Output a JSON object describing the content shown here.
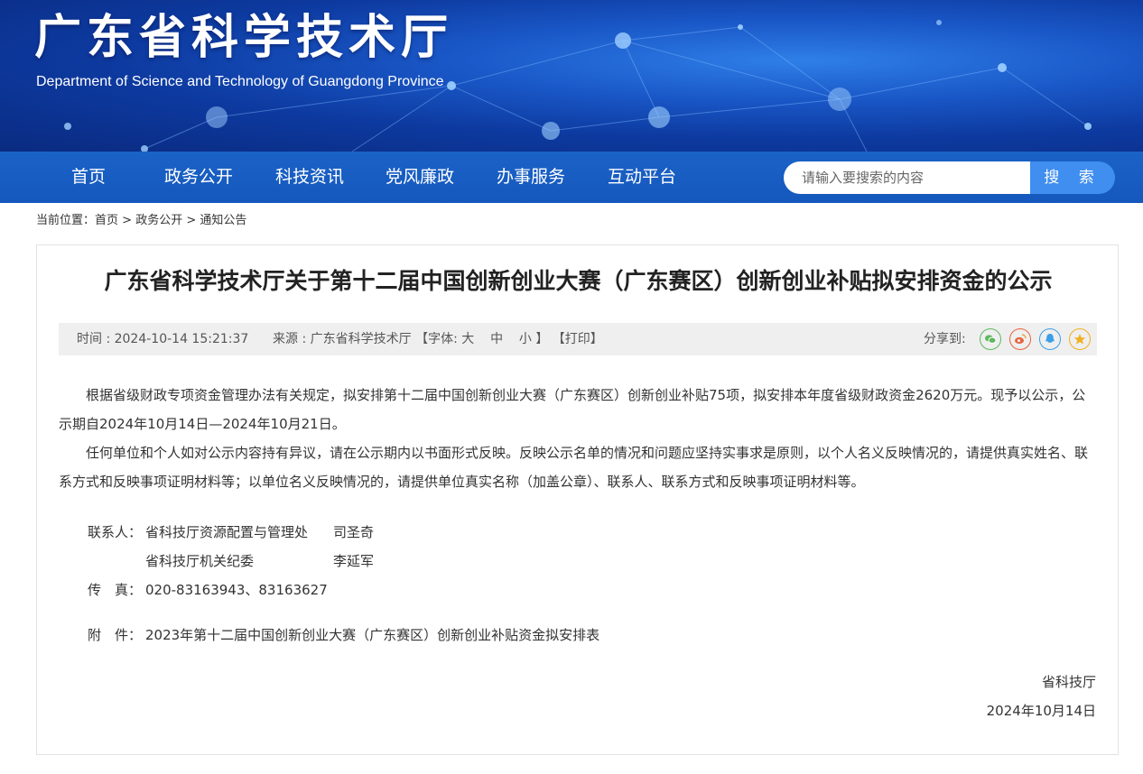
{
  "header": {
    "title": "广东省科学技术厅",
    "subtitle": "Department of Science and Technology of Guangdong Province"
  },
  "nav": {
    "items": [
      "首页",
      "政务公开",
      "科技资讯",
      "党风廉政",
      "办事服务",
      "互动平台"
    ]
  },
  "search": {
    "placeholder": "请输入要搜索的内容",
    "button": "搜 索"
  },
  "breadcrumb": {
    "prefix": "当前位置：",
    "items": [
      "首页",
      "政务公开",
      "通知公告"
    ],
    "sep": ">"
  },
  "article": {
    "title": "广东省科学技术厅关于第十二届中国创新创业大赛（广东赛区）创新创业补贴拟安排资金的公示",
    "meta": {
      "time": "时间 : 2024-10-14 15:21:37",
      "source": "来源 : 广东省科学技术厅",
      "font_open": "【字体:",
      "font_large": "大",
      "font_medium": "中",
      "font_small": "小",
      "font_close": "】",
      "print": "【打印】",
      "share_label": "分享到:"
    },
    "share_icons": [
      "wechat-icon",
      "weibo-icon",
      "qq-icon",
      "qzone-icon"
    ],
    "paragraphs": [
      "根据省级财政专项资金管理办法有关规定，拟安排第十二届中国创新创业大赛（广东赛区）创新创业补贴75项，拟安排本年度省级财政资金2620万元。现予以公示，公示期自2024年10月14日—2024年10月21日。",
      "任何单位和个人如对公示内容持有异议，请在公示期内以书面形式反映。反映公示名单的情况和问题应坚持实事求是原则，以个人名义反映情况的，请提供真实姓名、联系方式和反映事项证明材料等；以单位名义反映情况的，请提供单位真实名称（加盖公章）、联系人、联系方式和反映事项证明材料等。"
    ],
    "contacts": {
      "label": "联系人：",
      "rows": [
        {
          "dept": "省科技厅资源配置与管理处",
          "name": "司圣奇"
        },
        {
          "dept": "省科技厅机关纪委",
          "name": "李延军"
        }
      ],
      "fax_label": "传　真：",
      "fax": "020-83163943、83163627"
    },
    "attachment": {
      "label": "附　件：",
      "name": "2023年第十二届中国创新创业大赛（广东赛区）创新创业补贴资金拟安排表"
    },
    "signature": "省科技厅",
    "date": "2024年10月14日"
  },
  "colors": {
    "nav_bg": "#1b62c7",
    "search_btn": "#3f8ef0"
  }
}
